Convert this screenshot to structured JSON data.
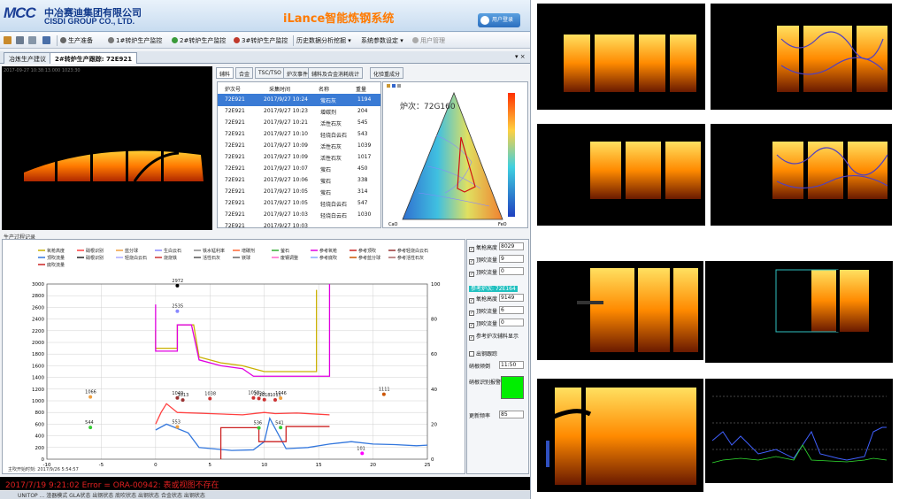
{
  "header": {
    "logo_mark": "MCC",
    "logo_cn": "中冶赛迪集团有限公司",
    "logo_en": "CISDI GROUP CO., LTD.",
    "system_title": "iLance智能炼钢系统",
    "login_button": "用户登录"
  },
  "menu": {
    "items": [
      "生产准备",
      "1#转炉生产监控",
      "2#转炉生产监控",
      "3#转炉生产监控",
      "历史数据分析挖掘 ▾",
      "系统参数设定 ▾",
      "用户管理"
    ]
  },
  "tabs": [
    "冶炼生产建议",
    "2#转炉生产跟踪: 72E921"
  ],
  "camera": {
    "timestamp": "2017-09-27 10:38:13.000  1023:30"
  },
  "data_tabs": [
    "辅料",
    "合金",
    "TSC/TSO",
    "炉次事件",
    "辅料及合金消耗统计",
    "化验重成分"
  ],
  "table": {
    "headers": [
      "炉次号",
      "采集时间",
      "名称",
      "重量"
    ],
    "rows": [
      [
        "72E921",
        "2017/9/27 10:24",
        "萤石灰",
        "1194"
      ],
      [
        "72E921",
        "2017/9/27 10:23",
        "增碳剂",
        "204"
      ],
      [
        "72E921",
        "2017/9/27 10:21",
        "活性石灰",
        "545"
      ],
      [
        "72E921",
        "2017/9/27 10:10",
        "轻烧白云石",
        "543"
      ],
      [
        "72E921",
        "2017/9/27 10:09",
        "活性石灰",
        "1039"
      ],
      [
        "72E921",
        "2017/9/27 10:09",
        "活性石灰",
        "1017"
      ],
      [
        "72E921",
        "2017/9/27 10:07",
        "萤石",
        "450"
      ],
      [
        "72E921",
        "2017/9/27 10:06",
        "萤石",
        "338"
      ],
      [
        "72E921",
        "2017/9/27 10:05",
        "萤石",
        "314"
      ],
      [
        "72E921",
        "2017/9/27 10:05",
        "轻烧白云石",
        "547"
      ],
      [
        "72E921",
        "2017/9/27 10:03",
        "轻烧白云石",
        "1030"
      ],
      [
        "72E921",
        "2017/9/27 10:03",
        "",
        ""
      ]
    ]
  },
  "ternary": {
    "label": "炉次：72G160",
    "bottom_left": "CaO",
    "bottom_right": "FeO"
  },
  "chart": {
    "section_title": "生产过程记录",
    "start_time": "主吹开始时刻: 2017/9/26 5:54:57",
    "legend": [
      {
        "name": "氧枪高度",
        "color": "#c9b000"
      },
      {
        "name": "硝根识别",
        "color": "#ff4040"
      },
      {
        "name": "蓝分球",
        "color": "#f0a040"
      },
      {
        "name": "生白云石",
        "color": "#8888ff"
      },
      {
        "name": "铁水锰利率",
        "color": "#888888"
      },
      {
        "name": "增碳剂",
        "color": "#ff6633"
      },
      {
        "name": "萤石",
        "color": "#33aa33"
      },
      {
        "name": "参考氧枪",
        "color": "#e000e0"
      },
      {
        "name": "参考顶吹",
        "color": "#cc2222"
      },
      {
        "name": "参考轻烧白云石",
        "color": "#993333"
      },
      {
        "name": "顶吹流量",
        "color": "#3377dd"
      },
      {
        "name": "硝根识别",
        "color": "#222222"
      },
      {
        "name": "轻烧白云石",
        "color": "#aaaaff"
      },
      {
        "name": "烧烧铁",
        "color": "#cc3333"
      },
      {
        "name": "活性石灰",
        "color": "#555555"
      },
      {
        "name": "镁球",
        "color": "#666666"
      },
      {
        "name": "废钢调整",
        "color": "#ff66cc"
      },
      {
        "name": "参考底吹",
        "color": "#88aaff"
      },
      {
        "name": "参考蓝分球",
        "color": "#cc5500"
      },
      {
        "name": "参考活性石灰",
        "color": "#aa6666"
      },
      {
        "name": "底吹流量",
        "color": "#cc2222"
      }
    ],
    "labels": [
      "2972",
      "2535",
      "1066",
      "544",
      "553",
      "1038",
      "1049",
      "1013",
      "1050",
      "1039",
      "1018",
      "1046",
      "1015",
      "536",
      "541",
      "1111",
      "101"
    ]
  },
  "chart_data": {
    "type": "line",
    "title": "",
    "xlim": [
      -10,
      25
    ],
    "ylim_left": [
      0,
      3000
    ],
    "ylim_right": [
      0,
      100
    ],
    "x_ticks": [
      -10,
      -5,
      0,
      5,
      10,
      15,
      20,
      25
    ],
    "y_left_ticks": [
      0,
      200,
      400,
      600,
      800,
      1000,
      1200,
      1400,
      1600,
      1800,
      2000,
      2200,
      2400,
      2600,
      2800,
      3000
    ],
    "y_right_ticks": [
      0,
      20,
      40,
      60,
      80,
      100
    ],
    "grid": true,
    "series": [
      {
        "name": "氧枪高度",
        "color": "#c9b000",
        "x": [
          0,
          0,
          2,
          2,
          3.5,
          4,
          6,
          8,
          10,
          14.5,
          14.8,
          14.8
        ],
        "y": [
          2200,
          1900,
          1900,
          2300,
          2300,
          1750,
          1650,
          1600,
          1500,
          1500,
          1500,
          2900
        ]
      },
      {
        "name": "参考氧枪",
        "color": "#e000e0",
        "x": [
          0,
          0,
          2,
          2,
          3.3,
          4,
          6,
          8,
          9,
          11,
          14,
          16,
          16
        ],
        "y": [
          2650,
          1850,
          1850,
          2300,
          2300,
          1700,
          1600,
          1550,
          1420,
          1420,
          1420,
          1420,
          3000
        ]
      },
      {
        "name": "顶吹流量",
        "color": "#3377dd",
        "x": [
          0,
          1,
          3,
          4,
          7,
          9,
          10,
          10.5,
          12,
          14,
          16,
          18,
          20,
          22,
          24,
          25
        ],
        "y": [
          500,
          600,
          450,
          200,
          150,
          160,
          300,
          700,
          180,
          200,
          260,
          300,
          260,
          250,
          230,
          240
        ]
      },
      {
        "name": "硝根识别",
        "color": "#ff4040",
        "x": [
          0,
          0.5,
          1,
          2,
          5,
          8,
          10,
          11,
          13,
          15,
          16
        ],
        "y": [
          600,
          800,
          950,
          800,
          780,
          760,
          800,
          780,
          790,
          770,
          760
        ]
      },
      {
        "name": "底吹流量",
        "color": "#cc2222",
        "x": [
          6,
          6,
          9.5,
          9.5,
          12,
          12,
          16
        ],
        "y": [
          0,
          540,
          540,
          300,
          300,
          560,
          560
        ]
      }
    ],
    "points": [
      {
        "x": 2,
        "y": 2972,
        "label": "2972",
        "color": "#000000"
      },
      {
        "x": 2,
        "y": 2535,
        "label": "2535",
        "color": "#8888ff"
      },
      {
        "x": -6,
        "y": 1066,
        "label": "1066",
        "color": "#f0a040"
      },
      {
        "x": -6,
        "y": 544,
        "label": "544",
        "color": "#33cc33"
      },
      {
        "x": 2,
        "y": 553,
        "label": "553",
        "color": "#f0a040"
      },
      {
        "x": 2,
        "y": 1049,
        "label": "1049",
        "color": "#993333"
      },
      {
        "x": 2.5,
        "y": 1013,
        "label": "1013",
        "color": "#993333"
      },
      {
        "x": 5,
        "y": 1038,
        "label": "1038",
        "color": "#cc3333"
      },
      {
        "x": 9,
        "y": 1050,
        "label": "1050",
        "color": "#cc3333"
      },
      {
        "x": 9.5,
        "y": 1039,
        "label": "1039",
        "color": "#cc3333"
      },
      {
        "x": 10,
        "y": 1018,
        "label": "1018",
        "color": "#cc3333"
      },
      {
        "x": 11.5,
        "y": 1046,
        "label": "1046",
        "color": "#f0a040"
      },
      {
        "x": 11,
        "y": 1015,
        "label": "1015",
        "color": "#cc3333"
      },
      {
        "x": 9.5,
        "y": 536,
        "label": "536",
        "color": "#33cc33"
      },
      {
        "x": 11.5,
        "y": 541,
        "label": "541",
        "color": "#33cc33"
      },
      {
        "x": 21,
        "y": 1111,
        "label": "1111",
        "color": "#cc5500"
      },
      {
        "x": 19,
        "y": 101,
        "label": "101",
        "color": "#ff00ff"
      }
    ]
  },
  "right_panel": {
    "rows": [
      {
        "label": "氧枪高度",
        "value": "8029",
        "checked": true
      },
      {
        "label": "顶吹流量",
        "value": "9",
        "checked": true
      },
      {
        "label": "顶吹流量",
        "value": "0",
        "checked": true
      },
      {
        "label": "参考炉次: 72E164",
        "value": "",
        "checked": false
      },
      {
        "label": "氧枪高度",
        "value": "9149",
        "checked": true
      },
      {
        "label": "顶吹流量",
        "value": "6",
        "checked": true
      },
      {
        "label": "顶吹流量",
        "value": "0",
        "checked": true
      },
      {
        "label": "参考炉次辅料显示",
        "value": "",
        "checked": true
      },
      {
        "label": "出钢跟踪",
        "value": "",
        "checked": false
      },
      {
        "label": "硝根倾倒",
        "value": "11:50",
        "checked": false
      },
      {
        "label": "硝根识别报警",
        "value": "",
        "checked": false
      },
      {
        "label": "更新频率",
        "value": "85",
        "checked": false
      }
    ],
    "alarm_color": "#00ee00"
  },
  "error_bar": "2017/7/19 9:21:02   Error = ORA-00942: 表或视图不存在",
  "status_bar": "UNITOP      ...   渣器模式  GLA状态   出钢状态   底吹状态   出钢状态   合金状态   出钢状态"
}
